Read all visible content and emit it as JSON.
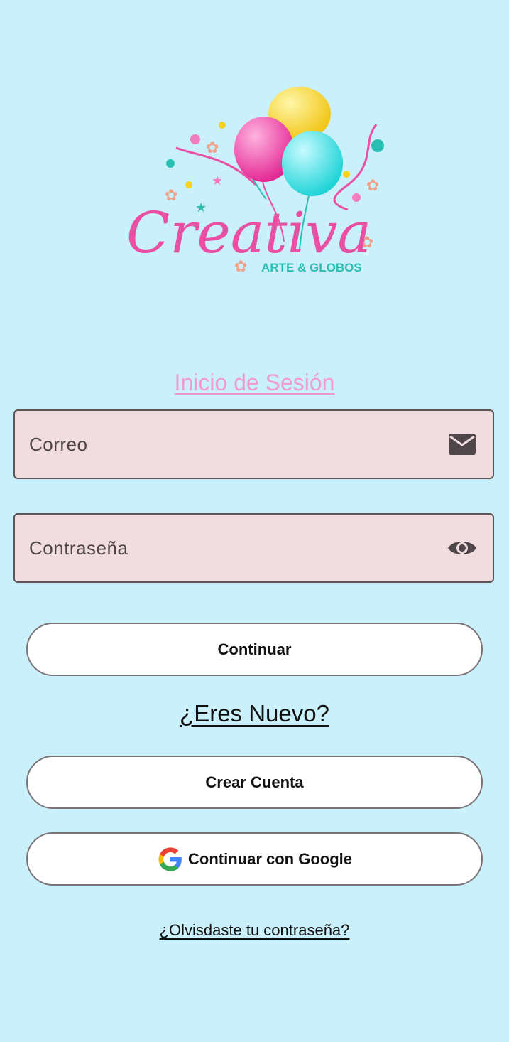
{
  "logo": {
    "brand": "Creativa",
    "tagline": "ARTE & GLOBOS",
    "colors": {
      "pink": "#e94fa3",
      "teal": "#2bbfb4",
      "yellow": "#f7d21c",
      "cyan": "#3fe0e4"
    }
  },
  "login": {
    "title": "Inicio de Sesión",
    "email_placeholder": "Correo",
    "email_icon": "mail-icon",
    "password_placeholder": "Contraseña",
    "password_icon": "eye-icon",
    "continue_label": "Continuar"
  },
  "signup": {
    "prompt": "¿Eres Nuevo?",
    "create_label": "Crear Cuenta",
    "google_label": "Continuar con Google",
    "google_icon": "google-icon"
  },
  "forgot_link": "¿Olvisdaste tu contraseña?",
  "colors": {
    "background": "#c9f0fb",
    "field_bg": "#f1dcdf",
    "title_pink": "#f39ad3"
  }
}
